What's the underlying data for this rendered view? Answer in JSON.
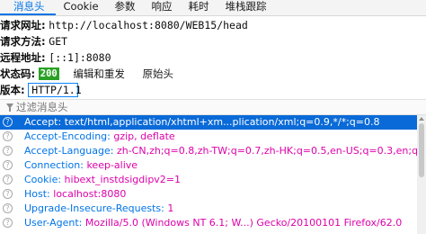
{
  "tabs": [
    {
      "label": "消息头"
    },
    {
      "label": "Cookie"
    },
    {
      "label": "参数"
    },
    {
      "label": "响应"
    },
    {
      "label": "耗时"
    },
    {
      "label": "堆栈跟踪"
    }
  ],
  "summary": {
    "url_label": "请求网址:",
    "url_value": "http://localhost:8080/WEB15/head",
    "method_label": "请求方法:",
    "method_value": "GET",
    "remote_label": "远程地址:",
    "remote_value": "[::1]:8080",
    "status_label": "状态码:",
    "status_value": "200",
    "edit_resend_label": "编辑和重发",
    "raw_headers_label": "原始头",
    "version_label": "版本:",
    "version_value": "HTTP/1.1"
  },
  "filter": {
    "placeholder": "过滤消息头"
  },
  "request_headers": [
    {
      "name": "Accept:",
      "value": "text/html,application/xhtml+xm...plication/xml;q=0.9,*/*;q=0.8"
    },
    {
      "name": "Accept-Encoding:",
      "value": "gzip, deflate"
    },
    {
      "name": "Accept-Language:",
      "value": "zh-CN,zh;q=0.8,zh-TW;q=0.7,zh-HK;q=0.5,en-US;q=0.3,en;q=0.2"
    },
    {
      "name": "Connection:",
      "value": "keep-alive"
    },
    {
      "name": "Cookie:",
      "value": "hibext_instdsigdipv2=1"
    },
    {
      "name": "Host:",
      "value": "localhost:8080"
    },
    {
      "name": "Upgrade-Insecure-Requests:",
      "value": "1"
    },
    {
      "name": "User-Agent:",
      "value": "Mozilla/5.0 (Windows NT 6.1; W...) Gecko/20100101 Firefox/62.0"
    }
  ],
  "colors": {
    "accent": "#0074e8",
    "header_value": "#dd00a9",
    "status_ok": "#2aa125",
    "selected_row": "#0a6ad8"
  }
}
